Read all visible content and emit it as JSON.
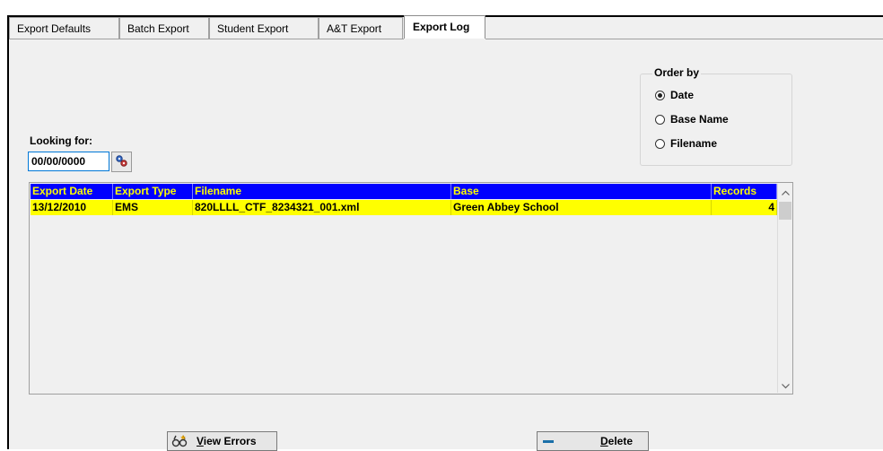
{
  "tabs": [
    {
      "label": "Export Defaults"
    },
    {
      "label": "Batch Export"
    },
    {
      "label": "Student Export"
    },
    {
      "label": "A&T Export"
    },
    {
      "label": "Export Log"
    }
  ],
  "active_tab": "Export Log",
  "order_by": {
    "title": "Order by",
    "options": [
      {
        "label": "Date",
        "checked": true
      },
      {
        "label": "Base Name",
        "checked": false
      },
      {
        "label": "Filename",
        "checked": false
      }
    ]
  },
  "search": {
    "label": "Looking for:",
    "value": "00/00/0000"
  },
  "grid": {
    "columns": [
      "Export Date",
      "Export Type",
      "Filename",
      "Base",
      "Records"
    ],
    "rows": [
      [
        "13/12/2010",
        "EMS",
        "820LLLL_CTF_8234321_001.xml",
        "Green Abbey School",
        "4"
      ]
    ]
  },
  "buttons": {
    "view_errors_prefix": "V",
    "view_errors_rest": "iew Errors",
    "delete_prefix": "D",
    "delete_rest": "elete"
  },
  "colors": {
    "header_bg": "#0000ff",
    "header_text": "#ffff00",
    "selected_row_bg": "#ffff00"
  }
}
